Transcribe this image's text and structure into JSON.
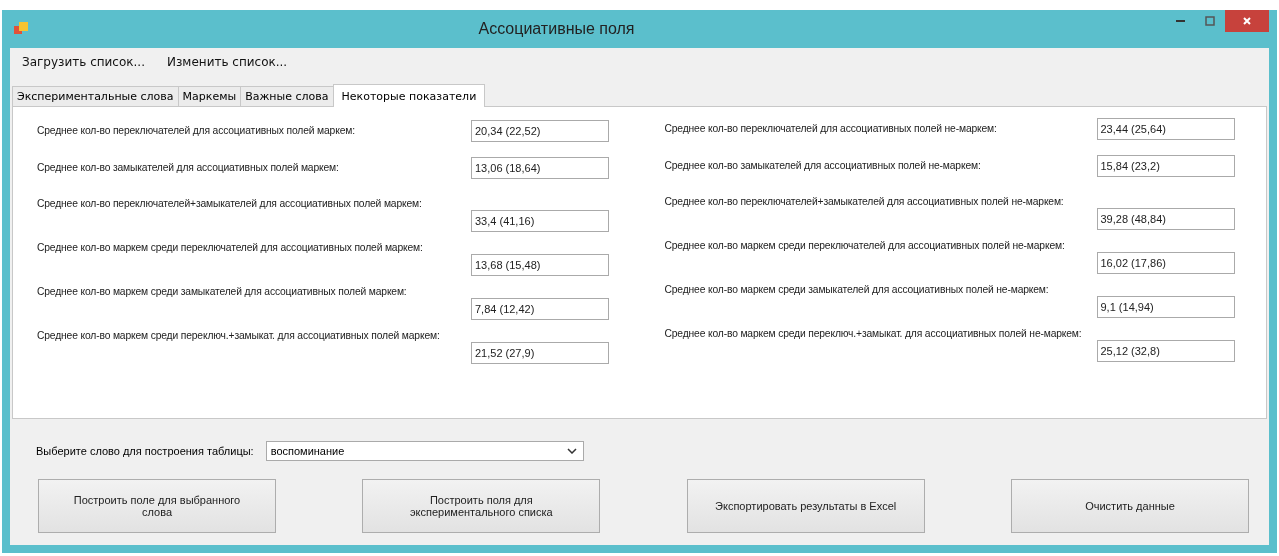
{
  "window": {
    "title": "Ассоциативные поля"
  },
  "menu": [
    "Загрузить список...",
    "Изменить список..."
  ],
  "tabs": [
    {
      "label": "Экспериментальные слова",
      "selected": false
    },
    {
      "label": "Маркемы",
      "selected": false
    },
    {
      "label": "Важные слова",
      "selected": false
    },
    {
      "label": "Некоторые показатели",
      "selected": true
    }
  ],
  "stats_left": [
    {
      "kind": "inline",
      "label": "Среднее кол-во переключателей для ассоциативных полей маркем:",
      "value": "20,34 (22,52)"
    },
    {
      "kind": "inline",
      "label": "Среднее кол-во замыкателей для ассоциативных полей маркем:",
      "value": "13,06 (18,64)"
    },
    {
      "kind": "stacked",
      "label": "Среднее кол-во переключателей+замыкателей для ассоциативных полей маркем:",
      "value": "33,4 (41,16)"
    },
    {
      "kind": "stacked",
      "label": "Среднее кол-во маркем среди переключателей для ассоциативных полей маркем:",
      "value": "13,68 (15,48)"
    },
    {
      "kind": "stacked",
      "label": "Среднее кол-во маркем среди замыкателей для ассоциативных полей маркем:",
      "value": "7,84 (12,42)"
    },
    {
      "kind": "stacked",
      "label": "Среднее кол-во маркем среди переключ.+замыкат. для ассоциативных полей маркем:",
      "value": "21,52 (27,9)"
    }
  ],
  "stats_right": [
    {
      "kind": "inline",
      "label": "Среднее кол-во переключателей для ассоциативных полей не-маркем:",
      "value": "23,44 (25,64)"
    },
    {
      "kind": "inline",
      "label": "Среднее кол-во замыкателей для ассоциативных полей не-маркем:",
      "value": "15,84 (23,2)"
    },
    {
      "kind": "stacked",
      "label": "Среднее кол-во переключателей+замыкателей для ассоциативных полей не-маркем:",
      "value": "39,28 (48,84)"
    },
    {
      "kind": "stacked",
      "label": "Среднее кол-во маркем среди переключателей для ассоциативных полей не-маркем:",
      "value": "16,02 (17,86)"
    },
    {
      "kind": "stacked",
      "label": "Среднее кол-во маркем среди замыкателей для ассоциативных полей не-маркем:",
      "value": "9,1 (14,94)"
    },
    {
      "kind": "stacked",
      "label": "Среднее кол-во маркем среди переключ.+замыкат. для ассоциативных полей не-маркем:",
      "value": "25,12 (32,8)"
    }
  ],
  "word_select": {
    "label": "Выберите слово для построения таблицы:",
    "value": "воспоминание"
  },
  "buttons": [
    "Построить поле для выбранного слова",
    "Построить поля для экспериментального списка",
    "Экспортировать результаты в Excel",
    "Очистить данные"
  ]
}
